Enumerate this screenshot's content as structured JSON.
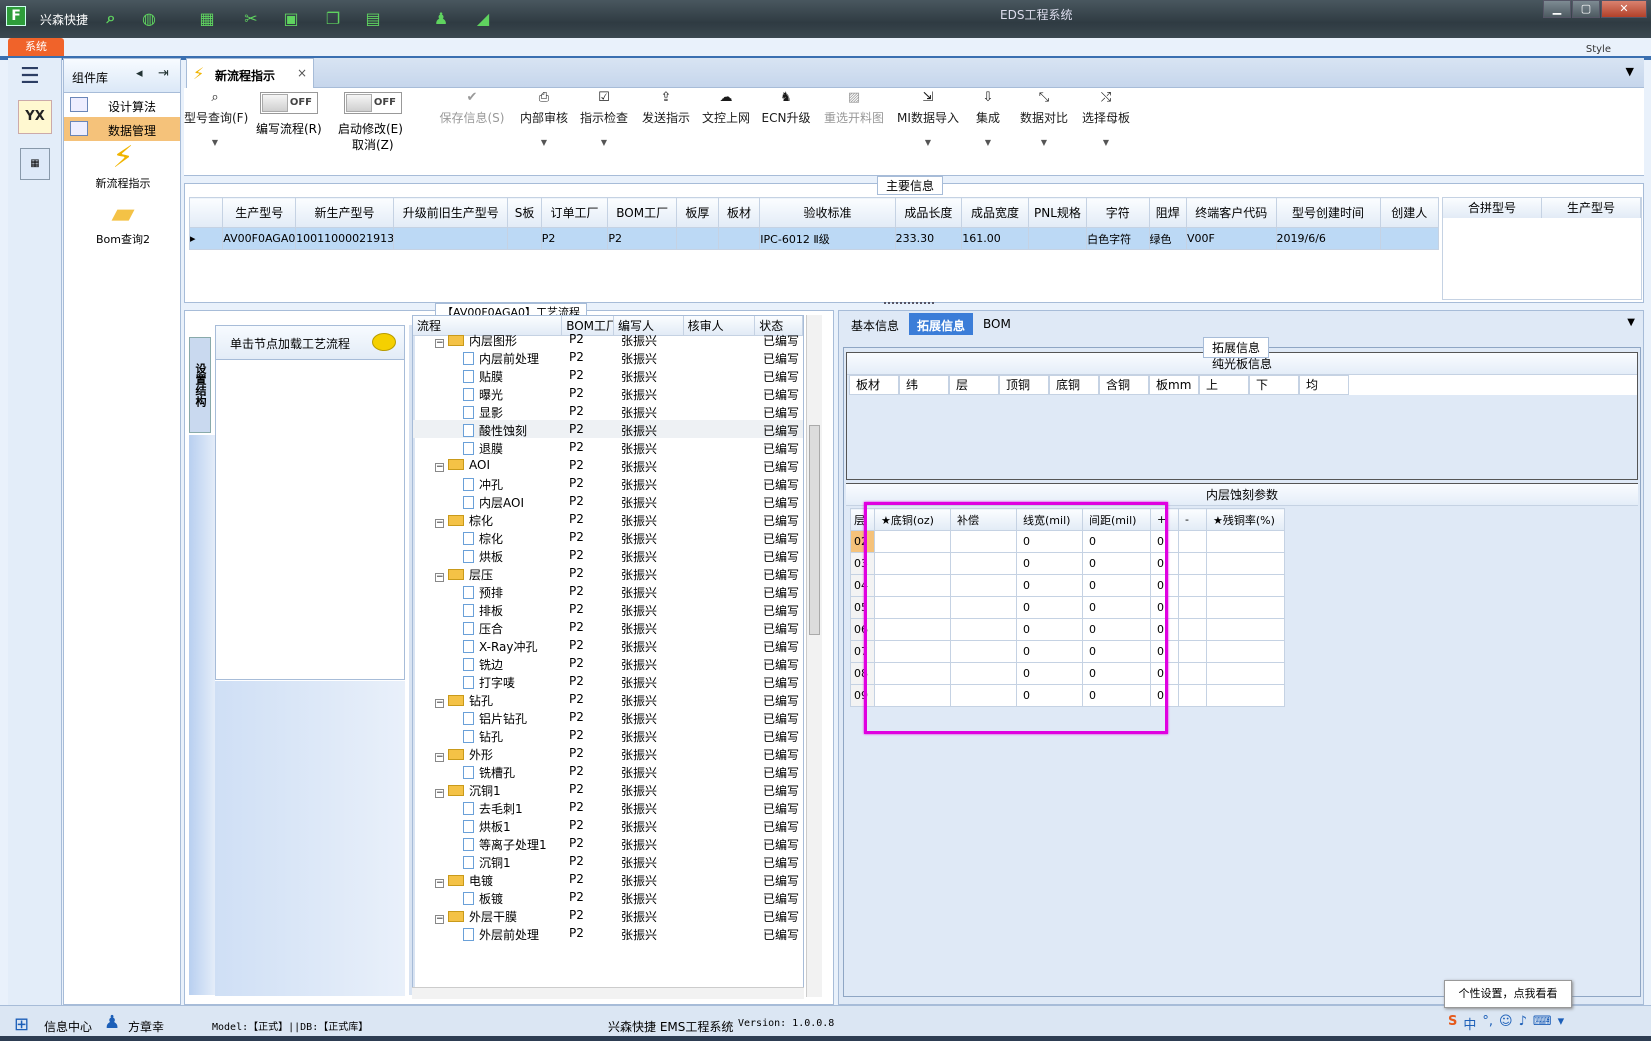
{
  "app": {
    "brand_letter": "F",
    "brand_name": "兴森快捷",
    "window_title": "EDS工程系统",
    "system_tab": "系统",
    "style_label": "Style",
    "win_min": "▁",
    "win_max": "▢",
    "win_close": "✕"
  },
  "sidebar": {
    "header": "组件库",
    "items": [
      {
        "label": "设计算法"
      },
      {
        "label": "数据管理"
      }
    ],
    "big": [
      {
        "label": "新流程指示",
        "icon": "lightning-icon"
      },
      {
        "label": "Bom查询2",
        "icon": "folder-icon"
      }
    ],
    "yx_label": "YX"
  },
  "document_tab": {
    "label": "新流程指示",
    "close": "×"
  },
  "toolbar": {
    "query": "型号查询(F)",
    "edit_toggle": "OFF",
    "edit_label": "编写流程(R)",
    "modify_toggle": "OFF",
    "modify_label1": "启动修改(E)",
    "modify_label2": "取消(Z)",
    "save": "保存信息(S)",
    "audit": "内部审核",
    "check": "指示检查",
    "send": "发送指示",
    "upload": "文控上网",
    "ecn": "ECN升级",
    "reselect": "重选开料图",
    "mi_import": "MI数据导入",
    "integrate": "集成",
    "compare": "数据对比",
    "select_mother": "选择母板"
  },
  "main_info": {
    "legend": "主要信息",
    "columns": [
      "生产型号",
      "新生产型号",
      "升级前旧生产型号",
      "S板",
      "订单工厂",
      "BOM工厂",
      "板厚",
      "板材",
      "验收标准",
      "成品长度",
      "成品宽度",
      "PNL规格",
      "字符",
      "阻焊",
      "终端客户代码",
      "型号创建时间",
      "创建人"
    ],
    "row": [
      "AV00F0AGA0",
      "10011000021913",
      "",
      "",
      "P2",
      "P2",
      "",
      "",
      "IPC-6012 Ⅱ级",
      "233.30",
      "161.00",
      "",
      "白色字符",
      "绿色",
      "V00F",
      "2019/6/6",
      ""
    ],
    "side_columns": [
      "合拼型号",
      "生产型号"
    ]
  },
  "flow": {
    "legend": "【AV00F0AGA0】工艺流程",
    "vtab": "设置结构",
    "node_hint": "单击节点加载工艺流程",
    "columns": [
      "流程",
      "BOM工厂",
      "编写人",
      "核审人",
      "状态"
    ],
    "rows": [
      {
        "name": "内层图形",
        "level": 0,
        "folder": true,
        "bom": "P2",
        "writer": "张振兴",
        "status": "已编写"
      },
      {
        "name": "内层前处理",
        "level": 1,
        "bom": "P2",
        "writer": "张振兴",
        "status": "已编写"
      },
      {
        "name": "贴膜",
        "level": 1,
        "bom": "P2",
        "writer": "张振兴",
        "status": "已编写"
      },
      {
        "name": "曝光",
        "level": 1,
        "bom": "P2",
        "writer": "张振兴",
        "status": "已编写"
      },
      {
        "name": "显影",
        "level": 1,
        "bom": "P2",
        "writer": "张振兴",
        "status": "已编写"
      },
      {
        "name": "酸性蚀刻",
        "level": 1,
        "bom": "P2",
        "writer": "张振兴",
        "status": "已编写",
        "hl": true
      },
      {
        "name": "退膜",
        "level": 1,
        "bom": "P2",
        "writer": "张振兴",
        "status": "已编写"
      },
      {
        "name": "AOI",
        "level": 0,
        "folder": true,
        "bom": "P2",
        "writer": "张振兴",
        "status": "已编写"
      },
      {
        "name": "冲孔",
        "level": 1,
        "bom": "P2",
        "writer": "张振兴",
        "status": "已编写"
      },
      {
        "name": "内层AOI",
        "level": 1,
        "bom": "P2",
        "writer": "张振兴",
        "status": "已编写"
      },
      {
        "name": "棕化",
        "level": 0,
        "folder": true,
        "bom": "P2",
        "writer": "张振兴",
        "status": "已编写"
      },
      {
        "name": "棕化",
        "level": 1,
        "bom": "P2",
        "writer": "张振兴",
        "status": "已编写"
      },
      {
        "name": "烘板",
        "level": 1,
        "bom": "P2",
        "writer": "张振兴",
        "status": "已编写"
      },
      {
        "name": "层压",
        "level": 0,
        "folder": true,
        "bom": "P2",
        "writer": "张振兴",
        "status": "已编写"
      },
      {
        "name": "预排",
        "level": 1,
        "bom": "P2",
        "writer": "张振兴",
        "status": "已编写"
      },
      {
        "name": "排板",
        "level": 1,
        "bom": "P2",
        "writer": "张振兴",
        "status": "已编写"
      },
      {
        "name": "压合",
        "level": 1,
        "bom": "P2",
        "writer": "张振兴",
        "status": "已编写"
      },
      {
        "name": "X-Ray冲孔",
        "level": 1,
        "bom": "P2",
        "writer": "张振兴",
        "status": "已编写"
      },
      {
        "name": "铣边",
        "level": 1,
        "bom": "P2",
        "writer": "张振兴",
        "status": "已编写"
      },
      {
        "name": "打字唛",
        "level": 1,
        "bom": "P2",
        "writer": "张振兴",
        "status": "已编写"
      },
      {
        "name": "钻孔",
        "level": 0,
        "folder": true,
        "bom": "P2",
        "writer": "张振兴",
        "status": "已编写"
      },
      {
        "name": "铝片钻孔",
        "level": 1,
        "bom": "P2",
        "writer": "张振兴",
        "status": "已编写"
      },
      {
        "name": "钻孔",
        "level": 1,
        "bom": "P2",
        "writer": "张振兴",
        "status": "已编写"
      },
      {
        "name": "外形",
        "level": 0,
        "folder": true,
        "bom": "P2",
        "writer": "张振兴",
        "status": "已编写"
      },
      {
        "name": "铣槽孔",
        "level": 1,
        "bom": "P2",
        "writer": "张振兴",
        "status": "已编写"
      },
      {
        "name": "沉铜1",
        "level": 0,
        "folder": true,
        "bom": "P2",
        "writer": "张振兴",
        "status": "已编写"
      },
      {
        "name": "去毛刺1",
        "level": 1,
        "bom": "P2",
        "writer": "张振兴",
        "status": "已编写"
      },
      {
        "name": "烘板1",
        "level": 1,
        "bom": "P2",
        "writer": "张振兴",
        "status": "已编写"
      },
      {
        "name": "等离子处理1",
        "level": 1,
        "bom": "P2",
        "writer": "张振兴",
        "status": "已编写"
      },
      {
        "name": "沉铜1",
        "level": 1,
        "bom": "P2",
        "writer": "张振兴",
        "status": "已编写"
      },
      {
        "name": "电镀",
        "level": 0,
        "folder": true,
        "bom": "P2",
        "writer": "张振兴",
        "status": "已编写"
      },
      {
        "name": "板镀",
        "level": 1,
        "bom": "P2",
        "writer": "张振兴",
        "status": "已编写"
      },
      {
        "name": "外层干膜",
        "level": 0,
        "folder": true,
        "bom": "P2",
        "writer": "张振兴",
        "status": "已编写"
      },
      {
        "name": "外层前处理",
        "level": 1,
        "bom": "P2",
        "writer": "张振兴",
        "status": "已编写"
      }
    ]
  },
  "right": {
    "tabs": [
      "基本信息",
      "拓展信息",
      "BOM"
    ],
    "active_tab": 1,
    "ext_legend": "拓展信息",
    "light_board": {
      "title": "纯光板信息",
      "columns": [
        "板材",
        "纬",
        "层",
        "顶铜",
        "底铜",
        "含铜",
        "板mm",
        "上",
        "下",
        "均"
      ]
    },
    "etch": {
      "title": "内层蚀刻参数",
      "columns": [
        "层",
        "★底铜(oz)",
        "补偿",
        "线宽(mil)",
        "间距(mil)",
        "+",
        "-",
        "★残铜率(%)"
      ],
      "rows": [
        [
          "02",
          "",
          "",
          "0",
          "0",
          "0",
          "",
          ""
        ],
        [
          "03",
          "",
          "",
          "0",
          "0",
          "0",
          "",
          ""
        ],
        [
          "04",
          "",
          "",
          "0",
          "0",
          "0",
          "",
          ""
        ],
        [
          "05",
          "",
          "",
          "0",
          "0",
          "0",
          "",
          ""
        ],
        [
          "06",
          "",
          "",
          "0",
          "0",
          "0",
          "",
          ""
        ],
        [
          "07",
          "",
          "",
          "0",
          "0",
          "0",
          "",
          ""
        ],
        [
          "08",
          "",
          "",
          "0",
          "0",
          "0",
          "",
          ""
        ],
        [
          "09",
          "",
          "",
          "0",
          "0",
          "0",
          "",
          ""
        ]
      ]
    }
  },
  "status": {
    "info_center": "信息中心",
    "user": "方章幸",
    "model_db": "Model:【正式】||DB:【正式库】",
    "system_name": "兴森快捷 EMS工程系统",
    "version": "Version: 1.0.0.8",
    "tooltip": "个性设置，点我看看",
    "ime": "中"
  }
}
